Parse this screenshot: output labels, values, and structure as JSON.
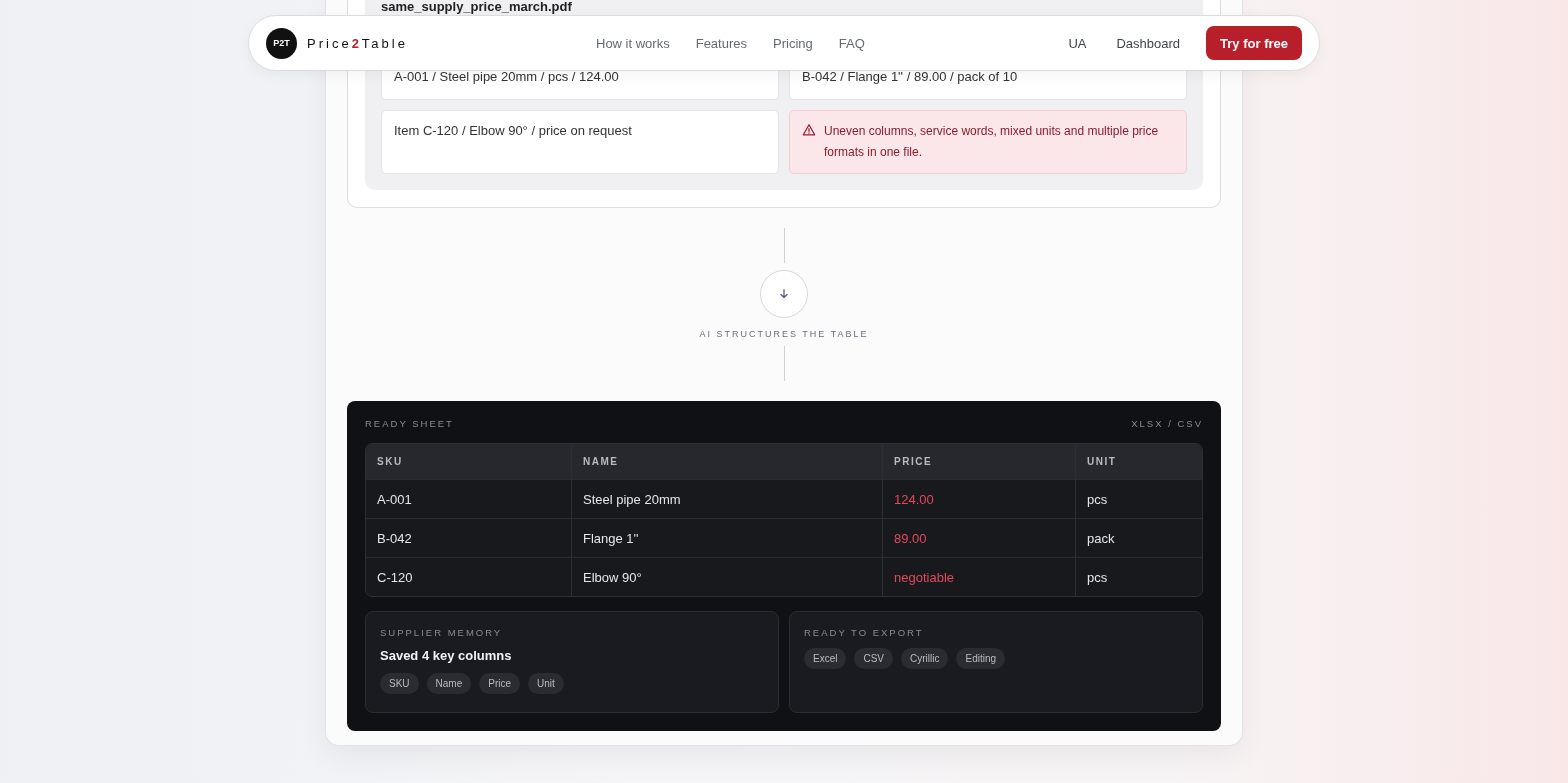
{
  "nav": {
    "logo_mark": "P2T",
    "brand": [
      {
        "text": "Price",
        "accent": false
      },
      {
        "text": "2",
        "accent": true
      },
      {
        "text": "Table",
        "accent": false
      }
    ],
    "links": [
      "How it works",
      "Features",
      "Pricing",
      "FAQ"
    ],
    "language": "UA",
    "dashboard": "Dashboard",
    "cta": "Try for free"
  },
  "source": {
    "file_name": "same_supply_price_march.pdf",
    "lines": [
      {
        "kind": "line",
        "text": "A-001 / Steel pipe 20mm / pcs / 124.00"
      },
      {
        "kind": "line",
        "text": "B-042 / Flange 1'' / 89.00 / pack of 10"
      },
      {
        "kind": "line",
        "text": "Item C-120 / Elbow 90° / price on request"
      },
      {
        "kind": "warning",
        "text": "Uneven columns, service words, mixed units and multiple price formats in one file."
      }
    ]
  },
  "step": {
    "label": "AI STRUCTURES THE TABLE"
  },
  "sheet": {
    "title": "READY SHEET",
    "formats": "XLSX / CSV",
    "columns": [
      "SKU",
      "NAME",
      "PRICE",
      "UNIT"
    ],
    "rows": [
      [
        "A-001",
        "Steel pipe 20mm",
        "124.00",
        "pcs"
      ],
      [
        "B-042",
        "Flange 1''",
        "89.00",
        "pack"
      ],
      [
        "C-120",
        "Elbow 90°",
        "negotiable",
        "pcs"
      ]
    ],
    "memory": {
      "title": "SUPPLIER MEMORY",
      "heading": "Saved 4 key columns",
      "tags": [
        "SKU",
        "Name",
        "Price",
        "Unit"
      ]
    },
    "export": {
      "title": "READY TO EXPORT",
      "tags": [
        "Excel",
        "CSV",
        "Cyrillic",
        "Editing"
      ]
    }
  }
}
